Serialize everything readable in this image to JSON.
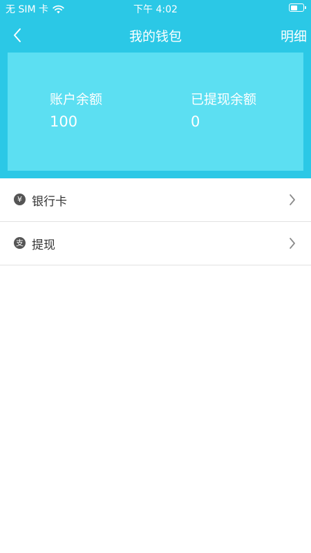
{
  "status_bar": {
    "carrier": "无 SIM 卡",
    "time": "下午 4:02",
    "icons": [
      "wifi-icon",
      "battery-icon"
    ]
  },
  "nav": {
    "title": "我的钱包",
    "detail_label": "明细",
    "back_icon": "chevron-left-icon"
  },
  "balance": {
    "account_label": "账户余额",
    "account_value": "100",
    "withdrawn_label": "已提现余额",
    "withdrawn_value": "0"
  },
  "menu": {
    "items": [
      {
        "label": "银行卡",
        "icon": "yen-icon",
        "glyph": "¥"
      },
      {
        "label": "提现",
        "icon": "alipay-icon",
        "glyph": "支"
      }
    ]
  },
  "colors": {
    "header": "#2bc8e6",
    "card": "#5cdff2",
    "divider": "#e2e2e2",
    "text": "#333333",
    "icon": "#555555"
  }
}
